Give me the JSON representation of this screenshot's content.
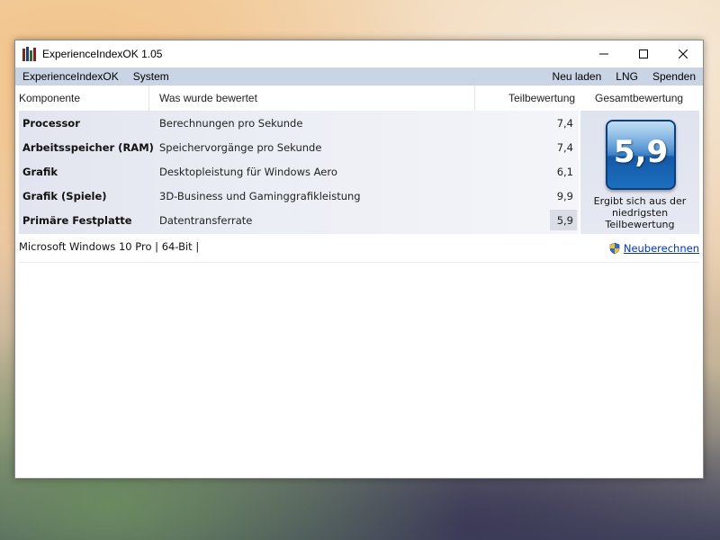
{
  "window": {
    "title": "ExperienceIndexOK 1.05",
    "controls": [
      "minimize",
      "maximize",
      "close"
    ]
  },
  "menu": {
    "left": [
      "ExperienceIndexOK",
      "System"
    ],
    "right": [
      "Neu laden",
      "LNG",
      "Spenden"
    ]
  },
  "table": {
    "headers": {
      "component": "Komponente",
      "rated": "Was wurde bewertet",
      "subscore": "Teilbewertung",
      "total": "Gesamtbewertung"
    },
    "rows": [
      {
        "component": "Processor",
        "description": "Berechnungen pro Sekunde",
        "score": "7,4"
      },
      {
        "component": "Arbeitsspeicher (RAM)",
        "description": "Speichervorgänge pro Sekunde",
        "score": "7,4"
      },
      {
        "component": "Grafik",
        "description": "Desktopleistung für Windows Aero",
        "score": "6,1"
      },
      {
        "component": "Grafik (Spiele)",
        "description": "3D-Business und Gaminggrafikleistung",
        "score": "9,9"
      },
      {
        "component": "Primäre Festplatte",
        "description": "Datentransferrate",
        "score": "5,9"
      }
    ]
  },
  "total": {
    "score": "5,9",
    "caption": "Ergibt sich aus der niedrigsten Teilbewertung"
  },
  "footer": {
    "sysinfo": "Microsoft Windows 10 Pro | 64-Bit |",
    "recalc_label": "Neuberechnen"
  },
  "colors": {
    "menubar": "#c9d5e4",
    "badge": "#2a78c6",
    "link": "#0033cc"
  }
}
